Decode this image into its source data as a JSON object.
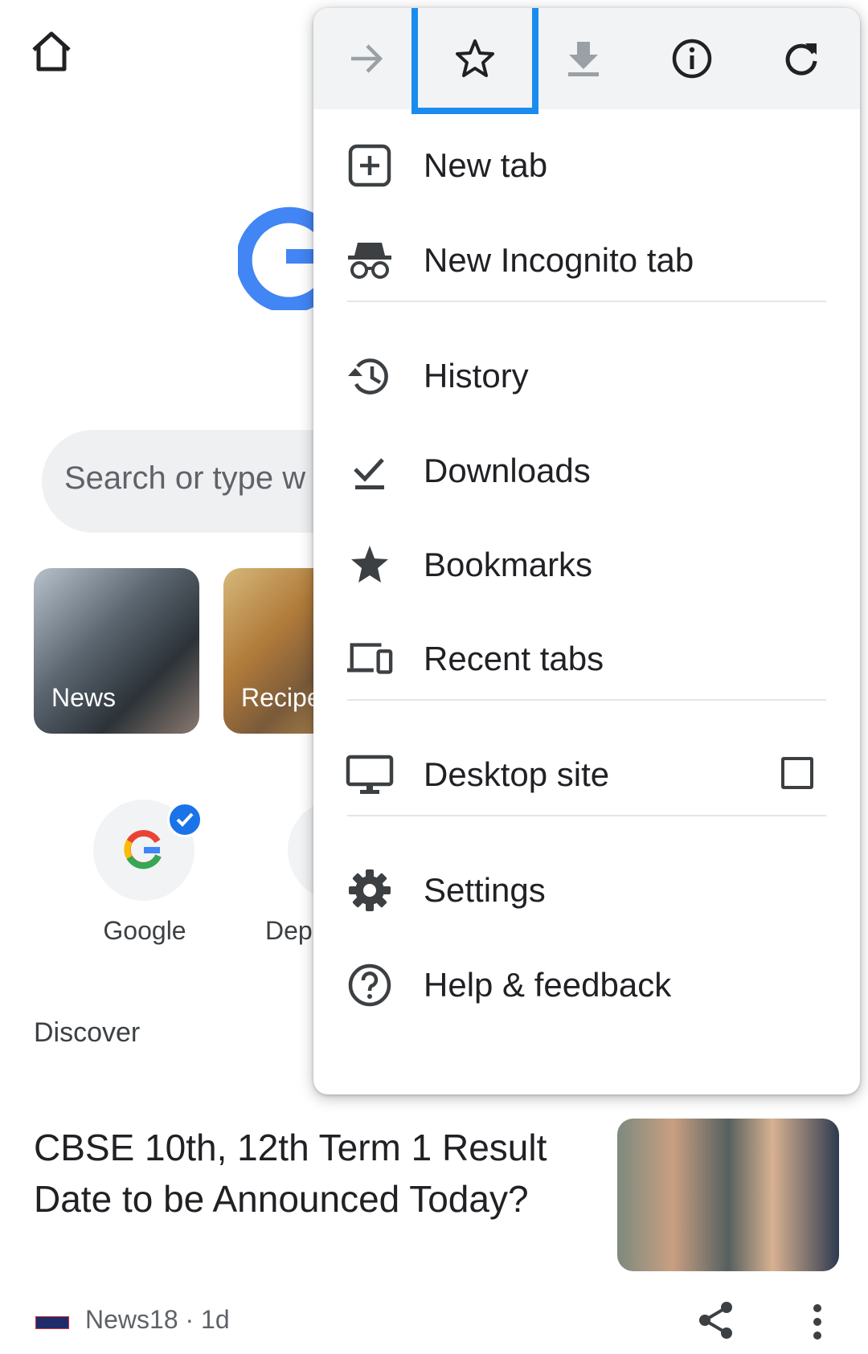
{
  "page": {
    "search_placeholder": "Search or type w",
    "tiles": [
      {
        "label": "News"
      },
      {
        "label": "Recipe"
      }
    ],
    "shortcuts": [
      {
        "label": "Google"
      },
      {
        "label": "Dep"
      }
    ],
    "discover_title": "Discover",
    "article": {
      "title": "CBSE 10th, 12th Term 1 Result Date to be Announced Today?",
      "source": "News18 · 1d"
    }
  },
  "menu": {
    "toolbar": [
      {
        "icon": "forward-arrow-icon"
      },
      {
        "icon": "bookmark-star-icon",
        "highlighted": true
      },
      {
        "icon": "download-icon"
      },
      {
        "icon": "info-icon"
      },
      {
        "icon": "reload-icon"
      }
    ],
    "items": [
      {
        "label": "New tab",
        "icon": "new-tab-icon"
      },
      {
        "label": "New Incognito tab",
        "icon": "incognito-icon"
      },
      {
        "label": "History",
        "icon": "history-icon"
      },
      {
        "label": "Downloads",
        "icon": "downloads-check-icon"
      },
      {
        "label": "Bookmarks",
        "icon": "bookmarks-star-icon"
      },
      {
        "label": "Recent tabs",
        "icon": "devices-icon"
      },
      {
        "label": "Desktop site",
        "icon": "desktop-icon",
        "checked": false
      },
      {
        "label": "Settings",
        "icon": "gear-icon"
      },
      {
        "label": "Help & feedback",
        "icon": "help-icon"
      }
    ]
  },
  "colors": {
    "highlight": "#1a8cf0",
    "google_blue": "#4285f4",
    "badge": "#1a73e8",
    "toolbar_bg": "#f1f3f4"
  }
}
